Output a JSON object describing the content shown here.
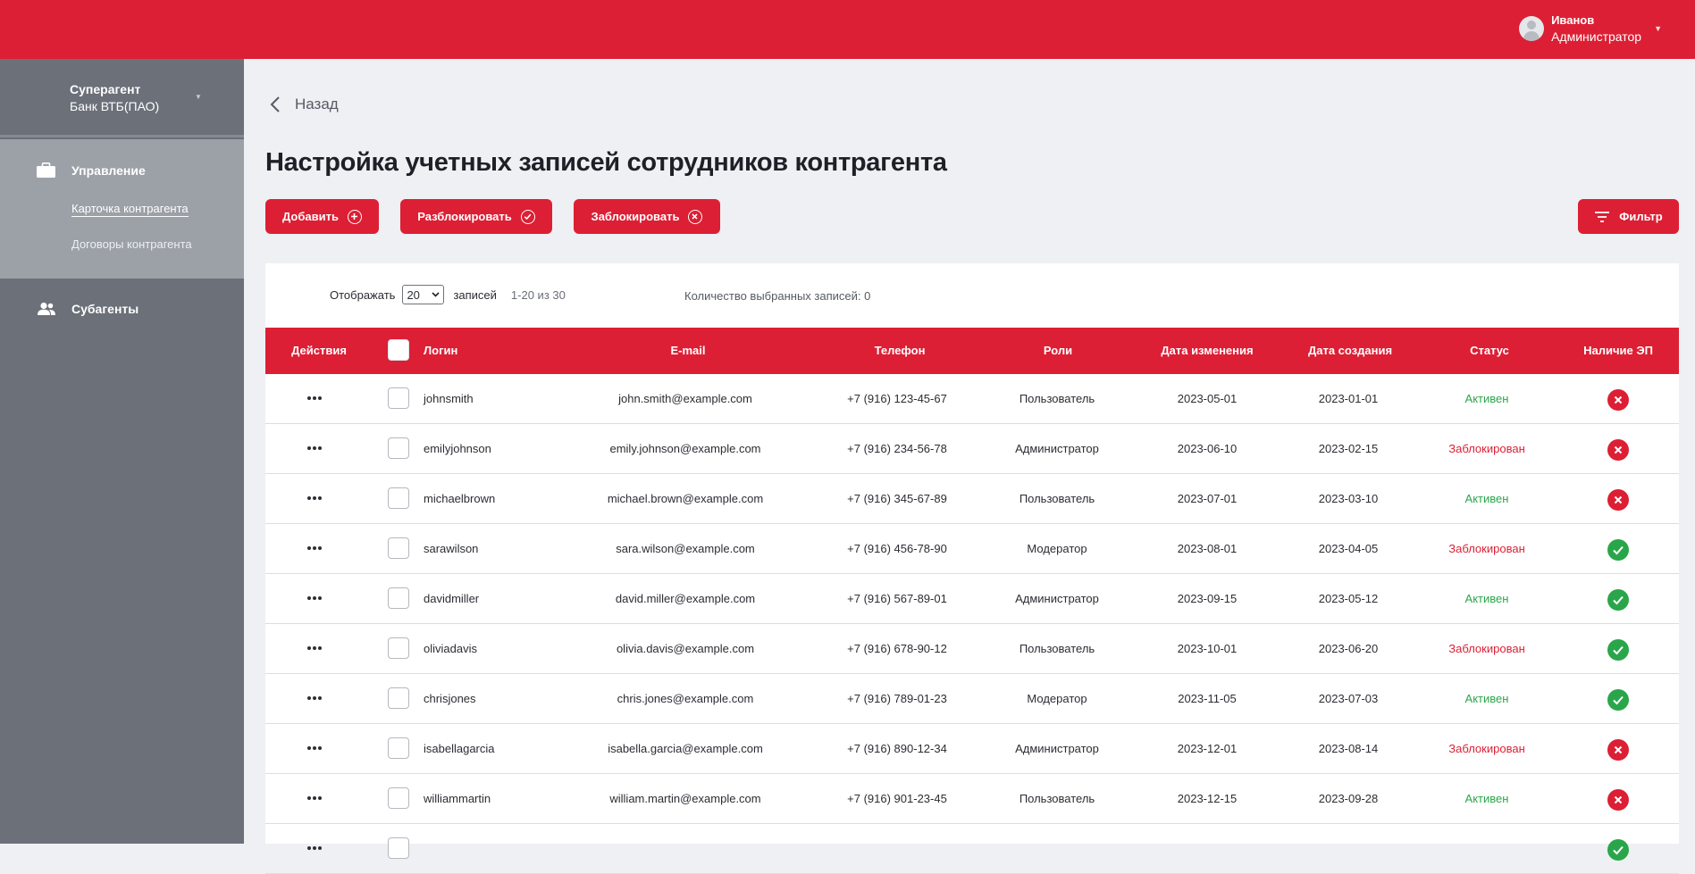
{
  "header": {
    "user_name": "Иванов",
    "user_role": "Администратор"
  },
  "sidebar": {
    "agent_title": "Суперагент",
    "agent_subtitle": "Банк ВТБ(ПАО)",
    "section_management": "Управление",
    "link_card": "Карточка контрагента",
    "link_contracts": "Договоры контрагента",
    "section_subagents": "Субагенты"
  },
  "main": {
    "back_label": "Назад",
    "title": "Настройка учетных записей сотрудников контрагента",
    "buttons": {
      "add": "Добавить",
      "unblock": "Разблокировать",
      "block": "Заблокировать",
      "filter": "Фильтр"
    },
    "pager": {
      "show_label": "Отображать",
      "page_size": "20",
      "records_label": "записей",
      "range": "1-20 из 30",
      "selected_count": "Количество выбранных записей: 0"
    }
  },
  "table": {
    "columns": [
      "Действия",
      "Логин",
      "E-mail",
      "Телефон",
      "Роли",
      "Дата изменения",
      "Дата создания",
      "Статус",
      "Наличие ЭП"
    ],
    "rows": [
      {
        "login": "johnsmith",
        "email": "john.smith@example.com",
        "phone": "+7 (916) 123-45-67",
        "role": "Пользователь",
        "modified": "2023-05-01",
        "created": "2023-01-01",
        "status": "Активен",
        "status_kind": "active",
        "ep": false
      },
      {
        "login": "emilyjohnson",
        "email": "emily.johnson@example.com",
        "phone": "+7 (916) 234-56-78",
        "role": "Администратор",
        "modified": "2023-06-10",
        "created": "2023-02-15",
        "status": "Заблокирован",
        "status_kind": "blocked",
        "ep": false
      },
      {
        "login": "michaelbrown",
        "email": "michael.brown@example.com",
        "phone": "+7 (916) 345-67-89",
        "role": "Пользователь",
        "modified": "2023-07-01",
        "created": "2023-03-10",
        "status": "Активен",
        "status_kind": "active",
        "ep": false
      },
      {
        "login": "sarawilson",
        "email": "sara.wilson@example.com",
        "phone": "+7 (916) 456-78-90",
        "role": "Модератор",
        "modified": "2023-08-01",
        "created": "2023-04-05",
        "status": "Заблокирован",
        "status_kind": "blocked",
        "ep": true
      },
      {
        "login": "davidmiller",
        "email": "david.miller@example.com",
        "phone": "+7 (916) 567-89-01",
        "role": "Администратор",
        "modified": "2023-09-15",
        "created": "2023-05-12",
        "status": "Активен",
        "status_kind": "active",
        "ep": true
      },
      {
        "login": "oliviadavis",
        "email": "olivia.davis@example.com",
        "phone": "+7 (916) 678-90-12",
        "role": "Пользователь",
        "modified": "2023-10-01",
        "created": "2023-06-20",
        "status": "Заблокирован",
        "status_kind": "blocked",
        "ep": true
      },
      {
        "login": "chrisjones",
        "email": "chris.jones@example.com",
        "phone": "+7 (916) 789-01-23",
        "role": "Модератор",
        "modified": "2023-11-05",
        "created": "2023-07-03",
        "status": "Активен",
        "status_kind": "active",
        "ep": true
      },
      {
        "login": "isabellagarcia",
        "email": "isabella.garcia@example.com",
        "phone": "+7 (916) 890-12-34",
        "role": "Администратор",
        "modified": "2023-12-01",
        "created": "2023-08-14",
        "status": "Заблокирован",
        "status_kind": "blocked",
        "ep": false
      },
      {
        "login": "williammartin",
        "email": "william.martin@example.com",
        "phone": "+7 (916) 901-23-45",
        "role": "Пользователь",
        "modified": "2023-12-15",
        "created": "2023-09-28",
        "status": "Активен",
        "status_kind": "active",
        "ep": false
      },
      {
        "login": "",
        "email": "",
        "phone": "",
        "role": "",
        "modified": "",
        "created": "",
        "status": "",
        "status_kind": "active",
        "ep": true
      }
    ]
  },
  "colors": {
    "brand_red": "#dc1f34",
    "active_green": "#2aa64a",
    "sidebar_gray": "#6b7079"
  }
}
